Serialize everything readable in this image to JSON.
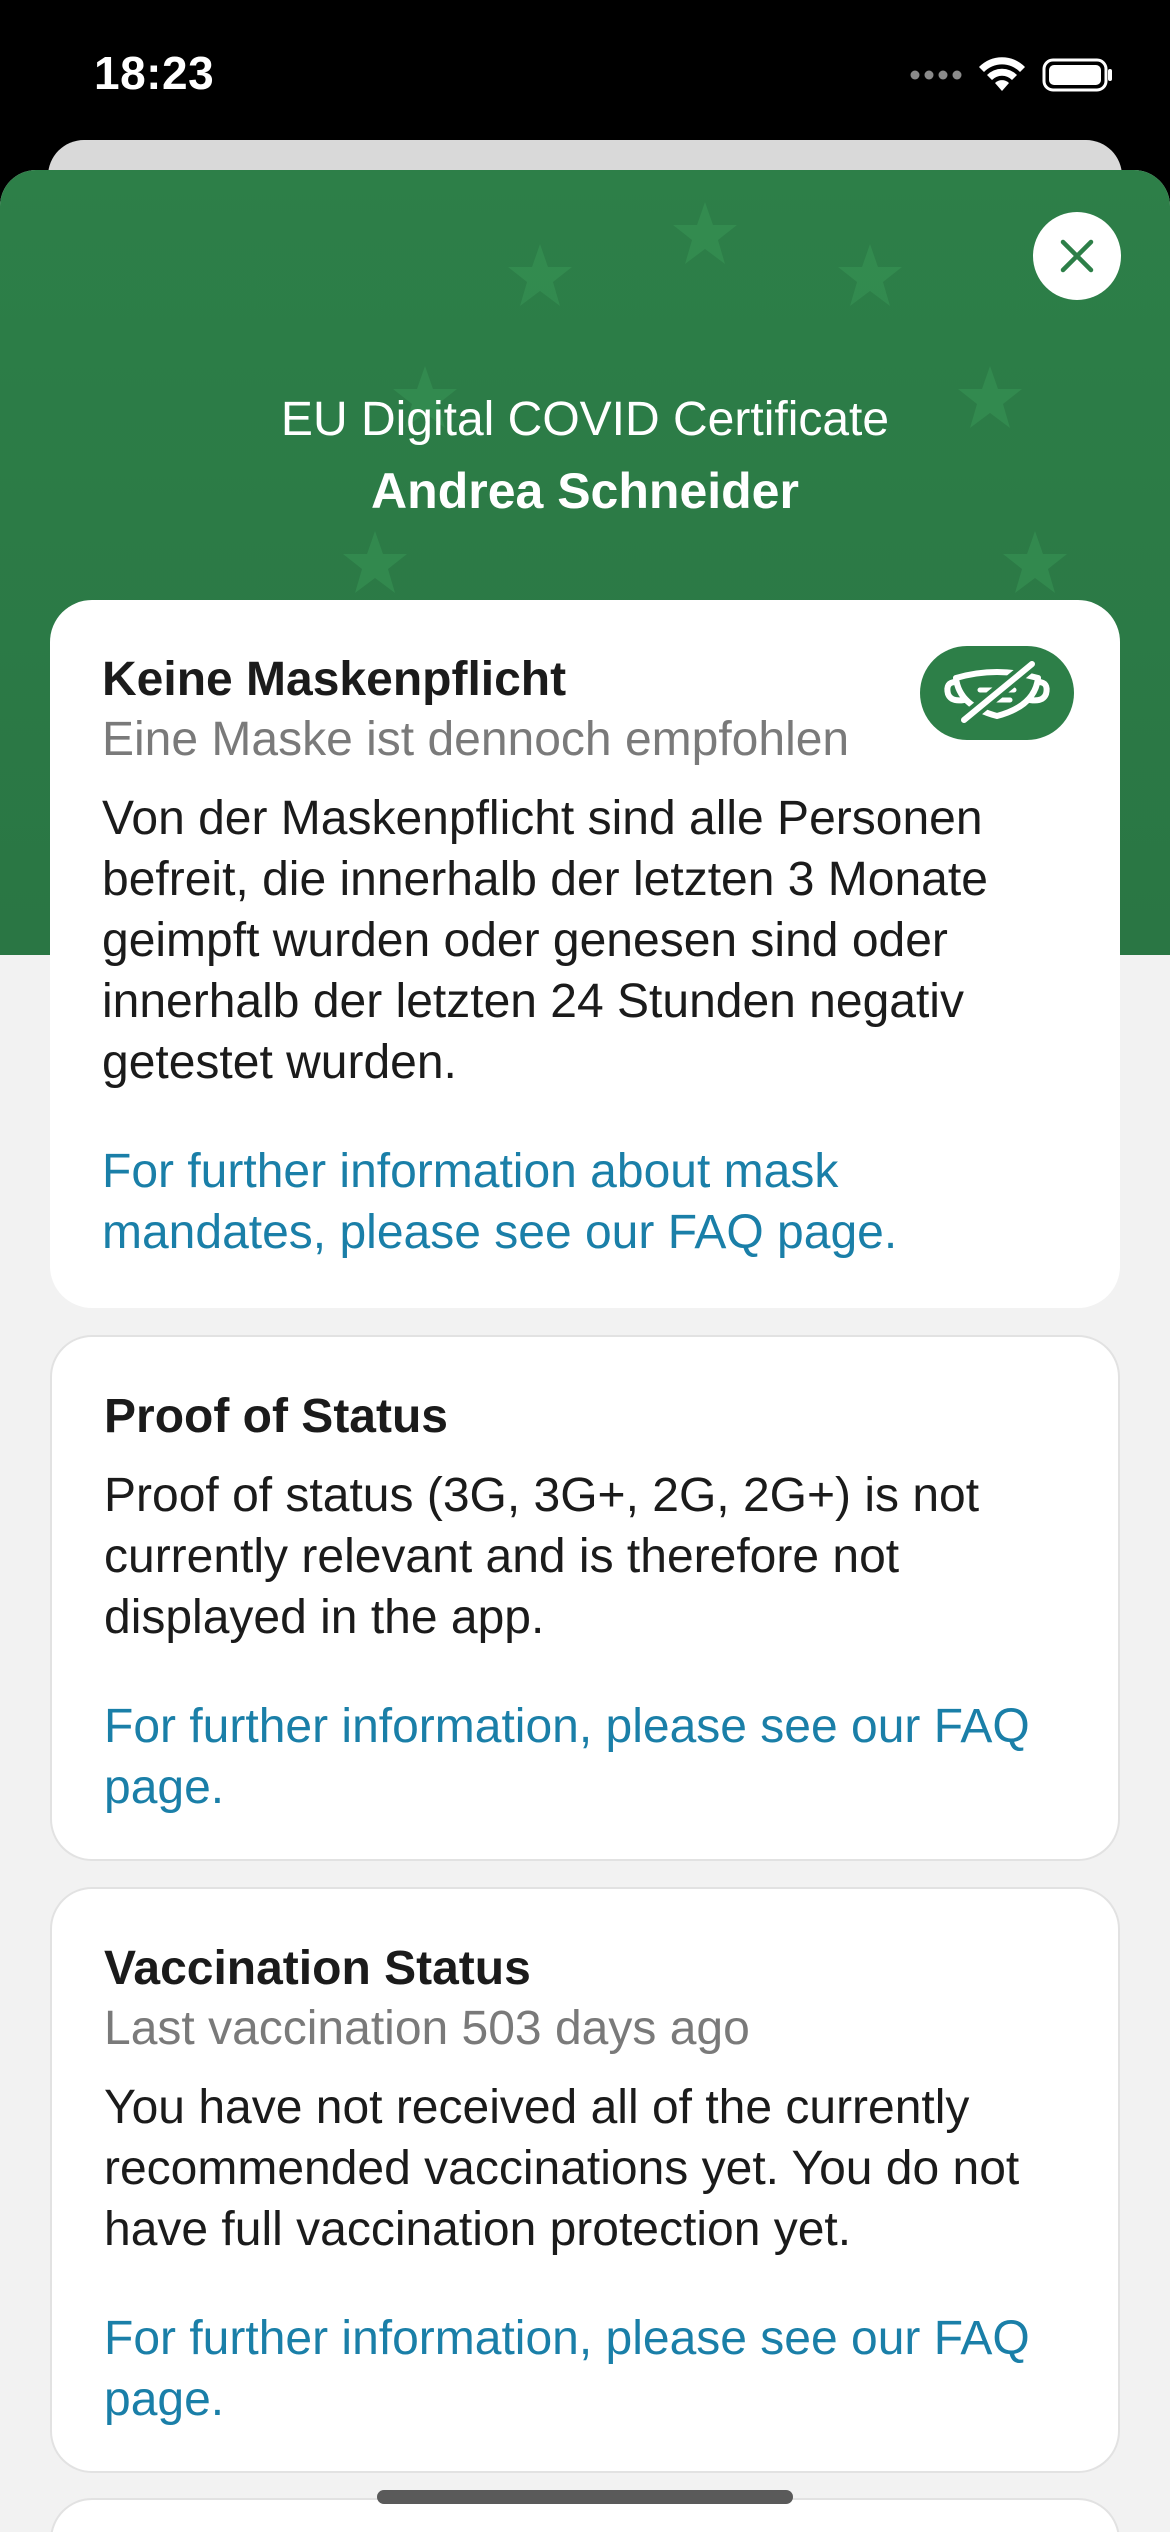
{
  "status_bar": {
    "time": "18:23"
  },
  "header": {
    "title": "EU Digital COVID Certificate",
    "name": "Andrea Schneider"
  },
  "icons": {
    "close": "close-icon",
    "mask": "no-mask-icon",
    "wifi": "wifi-icon",
    "battery": "battery-icon",
    "signal": "cellular-signal-icon"
  },
  "colors": {
    "header_green": "#2d7f48",
    "link_blue": "#1a7fa8",
    "background": "#f2f2f2"
  },
  "cards": {
    "mask": {
      "title": "Keine Maskenpflicht",
      "subtitle": "Eine Maske ist dennoch empfohlen",
      "body": "Von der Maskenpflicht sind alle Personen befreit, die innerhalb der letzten 3 Monate geimpft wurden oder genesen sind oder innerhalb der letzten 24 Stunden negativ getestet wurden.",
      "link": "For further information about mask mandates, please see our FAQ page."
    },
    "proof": {
      "title": "Proof of Status",
      "body": "Proof of status (3G, 3G+, 2G, 2G+) is not currently relevant and is therefore not displayed in the app.",
      "link": "For further information, please see our FAQ page."
    },
    "vaccination": {
      "title": "Vaccination Status",
      "subtitle": "Last vaccination 503 days ago",
      "body": "You have not received all of the currently recommended vaccinations yet. You do not have full vaccination protection yet.",
      "link": "For further information, please see our FAQ page."
    }
  }
}
